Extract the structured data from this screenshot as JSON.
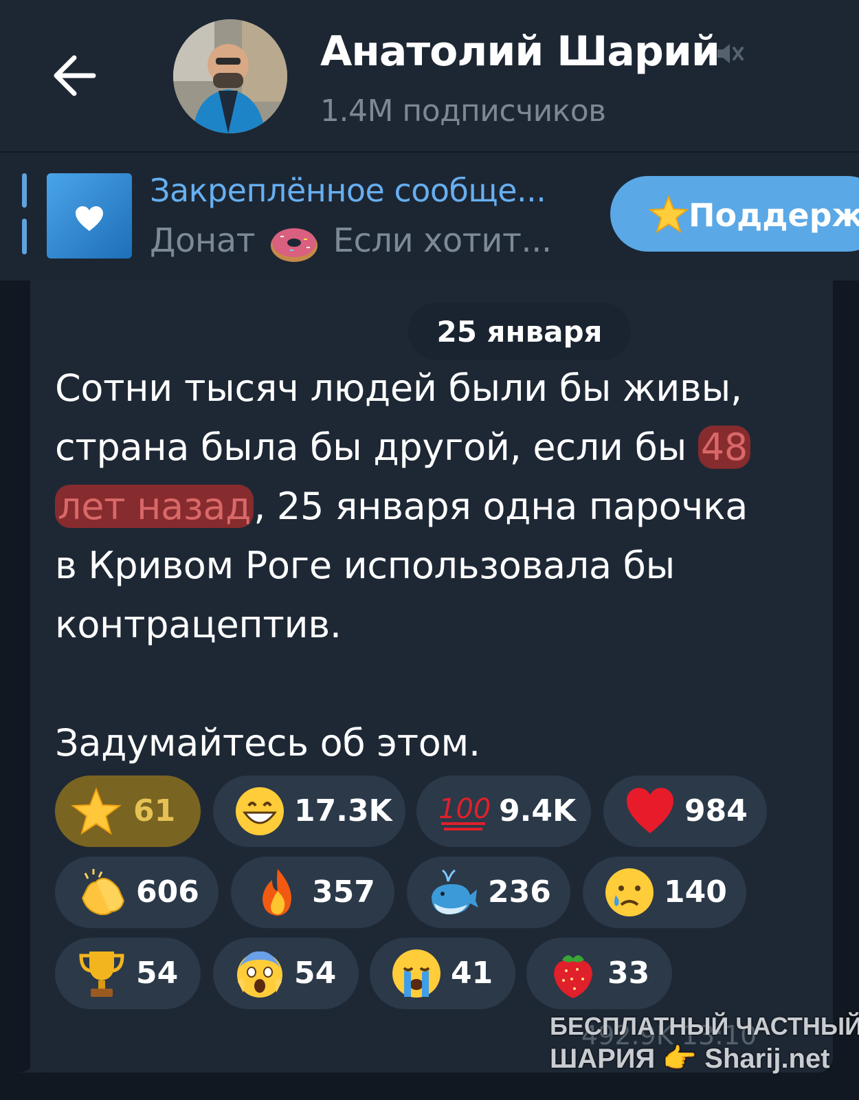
{
  "header": {
    "channel_name": "Анатолий Шарий",
    "subscribers": "1.4M подписчиков"
  },
  "pinned": {
    "title": "Закреплённое сообще...",
    "text_before": "Донат",
    "text_after": "Если хотит...",
    "button_label": "Поддерж"
  },
  "message": {
    "date": "25 января",
    "line1": "Сотни тысяч людей были бы живы,",
    "line2_a": "страна была бы другой, если бы ",
    "line2_hl": "48",
    "line3_hl": "лет назад",
    "line3_b": ", 25 января одна парочка",
    "line4": "в Кривом Роге использовала бы",
    "line5": "контрацептив.",
    "line6": "Задумайтесь об этом.",
    "views": "492.9K 13:10"
  },
  "reactions": [
    {
      "icon": "star-icon",
      "count": "61",
      "paid": true
    },
    {
      "icon": "grin-icon",
      "count": "17.3K"
    },
    {
      "icon": "hundred-icon",
      "count": "9.4K"
    },
    {
      "icon": "heart-icon",
      "count": "984"
    },
    {
      "icon": "clap-icon",
      "count": "606"
    },
    {
      "icon": "fire-icon",
      "count": "357"
    },
    {
      "icon": "whale-icon",
      "count": "236"
    },
    {
      "icon": "sad-icon",
      "count": "140"
    },
    {
      "icon": "trophy-icon",
      "count": "54"
    },
    {
      "icon": "scream-icon",
      "count": "54"
    },
    {
      "icon": "cry-icon",
      "count": "41"
    },
    {
      "icon": "strawberry-icon",
      "count": "33"
    }
  ],
  "watermark": {
    "line1": "БЕСПЛАТНЫЙ ЧАСТНЫЙ",
    "line2": "ШАРИЯ 👉 Sharij.net"
  },
  "colors": {
    "background": "#111821",
    "header": "#1d2733",
    "accent": "#5aa8e6",
    "highlight": "#aa2c2c",
    "reaction_pill": "#2b3949"
  }
}
